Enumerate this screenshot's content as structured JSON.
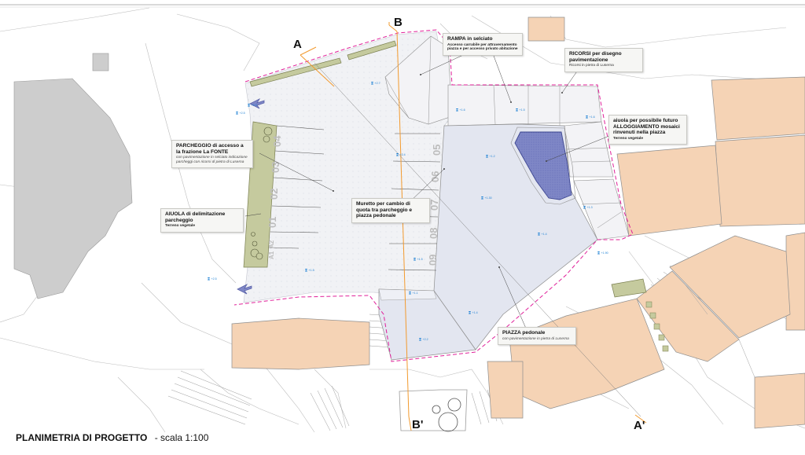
{
  "drawing": {
    "title": "PLANIMETRIA DI PROGETTO",
    "scale": "- scala 1:100"
  },
  "section_markers": {
    "a_top": "A",
    "b_top": "B",
    "b_bottom": "B'",
    "a_bottom": "A'"
  },
  "annotations": {
    "ramp": {
      "title": "RAMPA in selciato",
      "subtitle": "Accesso carrabile per attraversamento piazza e per accesso privato abitazione"
    },
    "ricorsi": {
      "title": "RICORSI per disegno pavimentazione",
      "subtitle": "Ricorsi in pietra di Luserna"
    },
    "aiuola_future": {
      "title": "aiuola per possibile futuro ALLOGGIAMENTO mosaici rinvenuti nella piazza",
      "subtitle": "Terreno vegetale"
    },
    "parking": {
      "title": "PARCHEGGIO di accesso a la frazione  La FONTE",
      "subtitle": "con pavimentazione in selciato indicazione parcheggi con ricorsi di pietra di Luserna"
    },
    "aiuola_limit": {
      "title": "AIUOLA di delimitazione parcheggio",
      "subtitle": "Terreno vegetale"
    },
    "muretto": {
      "title": "Muretto per cambio di quota tra parcheggio e piazza pedonale"
    },
    "piazza": {
      "title": "PIAZZA pedonale",
      "subtitle": "con pavimentazione in pietra di Luserna"
    }
  },
  "parking_labels": {
    "left": [
      "04",
      "03",
      "02",
      "01",
      "A2",
      "A1"
    ],
    "right": [
      "05",
      "06",
      "07",
      "08",
      "09"
    ]
  },
  "elevations": [
    "+2.7",
    "+2.5",
    "+1.6",
    "+1.5",
    "+1.6",
    "+2.4",
    "+1.2",
    "+1.3",
    "+1.4",
    "+1.5",
    "+2.5",
    "+1.5",
    "+1.1",
    "+1.4",
    "+2.2",
    "+2.5",
    "+1.30",
    "+1.4",
    "+1.90"
  ],
  "colors": {
    "building": "#f5d3b5",
    "building_stroke": "#8e8e8e",
    "plaza": "#e3e6f0",
    "parking": "#f1f2f5",
    "green_strip": "#c5ca9e",
    "flowerbed": "#7f87c6",
    "boundary": "#e0209a",
    "section_line": "#f29a2e",
    "neighbor_gray": "#cdcdcd",
    "marker_blue": "#1a7fd4"
  }
}
